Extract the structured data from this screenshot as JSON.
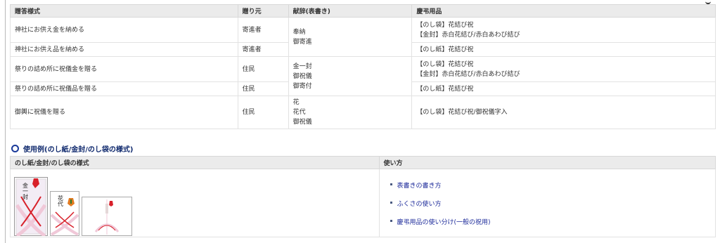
{
  "main_table": {
    "headers": [
      "贈答様式",
      "贈り元",
      "献辞(表書き)",
      "慶弔用品"
    ],
    "rows": [
      {
        "style": "神社にお供え金を納める",
        "from": "寄進者",
        "dedication": [
          "奉納",
          "御寄進"
        ],
        "goods": [
          "【のし袋】花結び祝",
          "【金封】赤白花結び/赤白あわび結び"
        ]
      },
      {
        "style": "神社にお供え品を納める",
        "from": "寄進者",
        "dedication": [],
        "goods": [
          "【のし紙】花結び祝"
        ]
      },
      {
        "style": "祭りの詰め所に祝儀金を贈る",
        "from": "住民",
        "dedication": [
          "金一封",
          "御祝儀",
          "御寄付"
        ],
        "goods": [
          "【のし袋】花結び祝",
          "【金封】赤白花結び/赤白あわび結び"
        ]
      },
      {
        "style": "祭りの詰め所に祝儀品を贈る",
        "from": "住民",
        "dedication": [],
        "goods": [
          "【のし紙】花結び祝"
        ]
      },
      {
        "style": "御輿に祝儀を贈る",
        "from": "住民",
        "dedication": [
          "花",
          "花代",
          "御祝儀"
        ],
        "goods": [
          "【のし袋】花結び祝/御祝儀字入"
        ]
      }
    ]
  },
  "section_title": "使用例(のし紙/金封/のし袋の様式)",
  "usage_table": {
    "headers": [
      "のし紙/金封/のし袋の様式",
      "使い方"
    ],
    "images": [
      {
        "label": "金一封",
        "icon": "noshi-envelope-kin-ippu"
      },
      {
        "label": "花代",
        "icon": "noshi-envelope-hanadai"
      },
      {
        "label": "",
        "icon": "noshi-paper"
      }
    ],
    "links": [
      "表書きの書き方",
      "ふくさの使い方",
      "慶弔用品の使い分け(一般の祝用)"
    ]
  },
  "colors": {
    "header_bg": "#ebebeb",
    "link": "#1c2a9a",
    "section_title": "#102a6e",
    "mizuhiki_red": "#d8202a"
  }
}
